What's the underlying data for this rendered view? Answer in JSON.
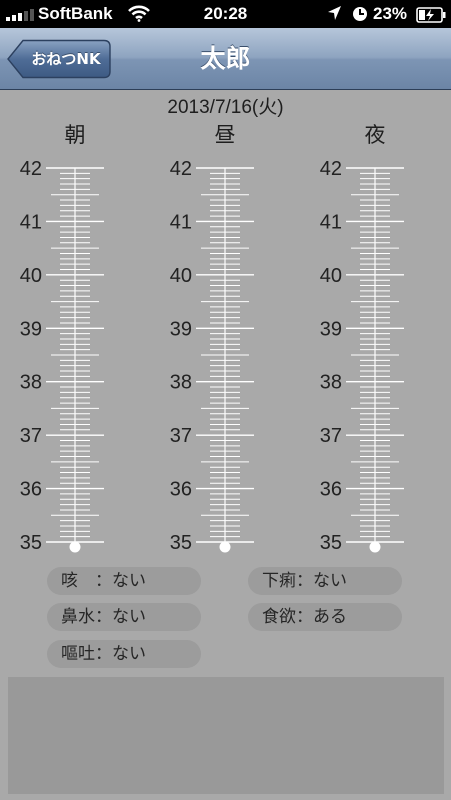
{
  "status_bar": {
    "carrier": "SoftBank",
    "time": "20:28",
    "battery_percent": "23%",
    "signal_bars": 3,
    "icons": [
      "signal-icon",
      "wifi-icon",
      "location-arrow-icon",
      "alarm-clock-icon",
      "battery-charging-icon"
    ]
  },
  "nav": {
    "back_label": "おねつNK",
    "title": "太郎"
  },
  "date": "2013/7/16(火)",
  "periods": [
    "朝",
    "昼",
    "夜"
  ],
  "scale": {
    "min": 35,
    "max": 42,
    "labels": [
      "42",
      "41",
      "40",
      "39",
      "38",
      "37",
      "36",
      "35"
    ]
  },
  "readings": {
    "morning": 35,
    "noon": 35,
    "night": 35
  },
  "symptoms": {
    "cough": "咳　：ない",
    "runny_nose": "鼻水：ない",
    "vomiting": "嘔吐：ない",
    "diarrhea": "下痢：ない",
    "appetite": "食欲：ある"
  },
  "colors": {
    "background": "#a9a9a9",
    "nav_bar": "#7d95b4",
    "tick": "#ffffff",
    "pill": "#9c9c9c"
  }
}
